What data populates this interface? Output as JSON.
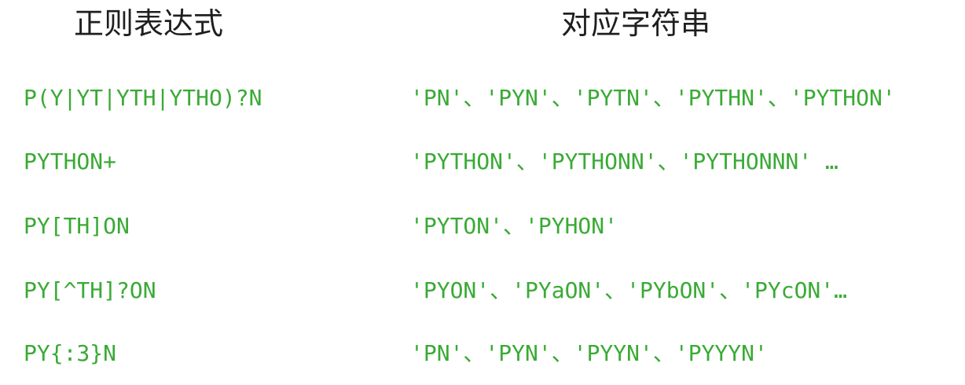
{
  "header": {
    "regex_label": "正则表达式",
    "strings_label": "对应字符串"
  },
  "rows": [
    {
      "regex": "P(Y|YT|YTH|YTHO)?N",
      "strings": "'PN'、'PYN'、'PYTN'、'PYTHN'、'PYTHON'"
    },
    {
      "regex": "PYTHON+",
      "strings": "'PYTHON'、'PYTHONN'、'PYTHONNN' …"
    },
    {
      "regex": "PY[TH]ON",
      "strings": "'PYTON'、'PYHON'"
    },
    {
      "regex": "PY[^TH]?ON",
      "strings": "'PYON'、'PYaON'、'PYbON'、'PYcON'…"
    },
    {
      "regex": "PY{:3}N",
      "strings": "'PN'、'PYN'、'PYYN'、'PYYYN'"
    }
  ],
  "colors": {
    "text_green": "#3aaa35",
    "header_text": "#1f1f1f",
    "background": "#ffffff"
  }
}
